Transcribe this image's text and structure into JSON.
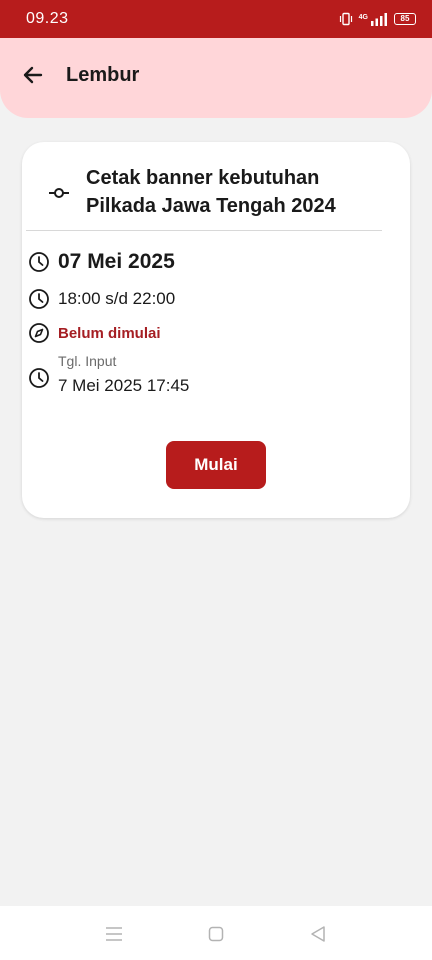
{
  "status_bar": {
    "time": "09.23",
    "network": "4G",
    "battery": "85"
  },
  "header": {
    "title": "Lembur",
    "back_icon": "arrow-left-icon"
  },
  "task": {
    "title_line1": "Cetak banner kebutuhan",
    "title_line2": "Pilkada Jawa Tengah 2024",
    "date": "07 Mei 2025",
    "time_range": "18:00 s/d 22:00",
    "status": "Belum dimulai",
    "input_label": "Tgl. Input",
    "input_value": "7 Mei 2025 17:45",
    "start_label": "Mulai"
  },
  "colors": {
    "primary": "#b71c1c",
    "header_bg": "#ffd6d9",
    "status_text": "#a51e23",
    "page_bg": "#f2f2f2"
  },
  "nav": {
    "icons": [
      "menu-icon",
      "home-square-icon",
      "back-triangle-icon"
    ]
  }
}
